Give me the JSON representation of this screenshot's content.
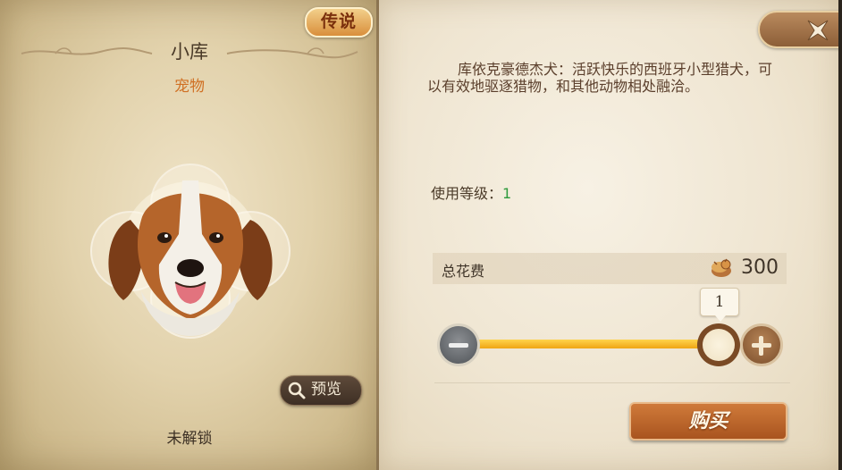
{
  "item": {
    "rarity_badge": "传说",
    "name": "小库",
    "type": "宠物",
    "preview_label": "预览",
    "unlock_status": "未解锁",
    "portrait_icon": "kooikerhondje-dog-portrait"
  },
  "details": {
    "description": "库依克豪德杰犬：活跃快乐的西班牙小型猎犬，可以有效地驱逐猎物，和其他动物相处融洽。",
    "level_label": "使用等级：",
    "level_value": "1"
  },
  "purchase": {
    "cost_label": "总花费",
    "cost_icon": "gold-coin-icon",
    "cost_value": "300",
    "quantity": "1",
    "slider_fraction": 1.0,
    "buy_label": "购买"
  },
  "colors": {
    "rarity_text": "#7a2f0c",
    "type_text": "#d07024",
    "level_value": "#2f9a3c",
    "slider_track": "#f0a514",
    "buy_button": "#b85f27"
  }
}
